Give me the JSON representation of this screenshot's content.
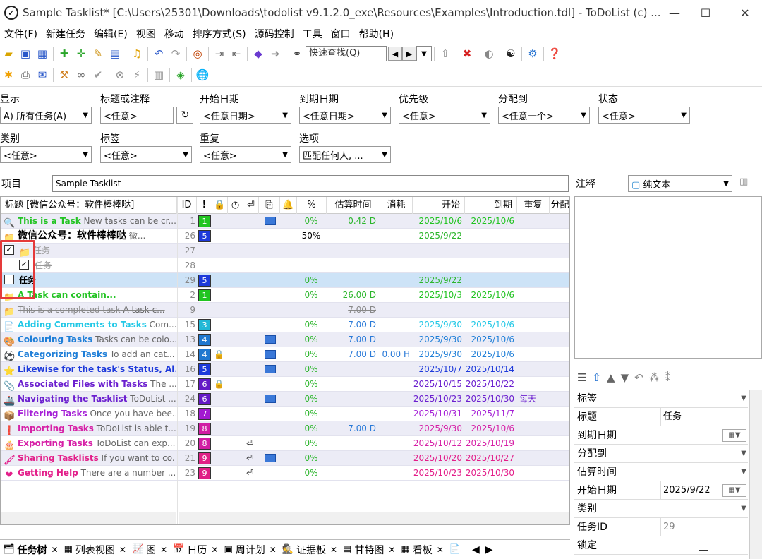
{
  "window": {
    "title": "Sample Tasklist* [C:\\Users\\25301\\Downloads\\todolist  v9.1.2.0_exe\\Resources\\Examples\\Introduction.tdl] - ToDoList (c) ...",
    "minimize": "—",
    "maximize": "☐",
    "close": "✕"
  },
  "menu": [
    "文件(F)",
    "新建任务",
    "编辑(E)",
    "视图",
    "移动",
    "排序方式(S)",
    "源码控制",
    "工具",
    "窗口",
    "帮助(H)"
  ],
  "toolbar": {
    "quick_find_placeholder": "快速查找(Q)"
  },
  "filters": {
    "show": {
      "label": "显示",
      "value": "A) 所有任务(A)"
    },
    "title_or_comment": {
      "label": "标题或注释",
      "value": "<任意>"
    },
    "start_date": {
      "label": "开始日期",
      "value": "<任意日期>"
    },
    "due_date": {
      "label": "到期日期",
      "value": "<任意日期>"
    },
    "priority": {
      "label": "优先级",
      "value": "<任意>"
    },
    "allocated_to": {
      "label": "分配到",
      "value": "<任意一个>"
    },
    "status": {
      "label": "状态",
      "value": "<任意>"
    },
    "category": {
      "label": "类别",
      "value": "<任意>"
    },
    "tags": {
      "label": "标签",
      "value": "<任意>"
    },
    "recurrence": {
      "label": "重复",
      "value": "<任意>"
    },
    "options": {
      "label": "选项",
      "value": "匹配任何人, ..."
    }
  },
  "project": {
    "label": "项目",
    "value": "Sample Tasklist"
  },
  "grid": {
    "columns": {
      "title": "标题 [微信公众号：软件棒棒哒]",
      "id": "ID",
      "priority": "!",
      "percent": "%",
      "estimate": "估算时间",
      "spent": "消耗",
      "start": "开始",
      "due": "到期",
      "recurrence": "重复",
      "alloc": "分配"
    },
    "rows": [
      {
        "title": "This is a Task",
        "comment": "New tasks can be cr...",
        "id": "1",
        "pri": "1",
        "pct": "0%",
        "est": "0.42 D",
        "spent": "",
        "start": "2025/10/6",
        "due": "2025/10/6",
        "rec": "",
        "color": "#22c322",
        "pricolor": "#21c521",
        "icon": "🔍"
      },
      {
        "title": "微信公众号：软件棒棒哒",
        "comment": "微...",
        "id": "26",
        "pri": "5",
        "pct": "50%",
        "est": "",
        "spent": "",
        "start": "2025/9/22",
        "due": "",
        "rec": "",
        "color": "#000000",
        "pricolor": "#1e3adb",
        "icon": "📁"
      },
      {
        "title": "任务",
        "comment": "",
        "id": "27",
        "pri": "",
        "pct": "",
        "est": "",
        "spent": "",
        "start": "",
        "due": "",
        "rec": "",
        "color": "#999999",
        "pricolor": "",
        "icon": "📁",
        "done": true
      },
      {
        "title": "任务",
        "comment": "",
        "id": "28",
        "pri": "",
        "pct": "",
        "est": "",
        "spent": "",
        "start": "",
        "due": "",
        "rec": "",
        "color": "#999999",
        "pricolor": "",
        "icon": "",
        "done": true
      },
      {
        "title": "任务",
        "comment": "",
        "id": "29",
        "pri": "5",
        "pct": "0%",
        "est": "",
        "spent": "",
        "start": "2025/9/22",
        "due": "",
        "rec": "",
        "color": "#000000",
        "pricolor": "#1e3adb",
        "icon": ""
      },
      {
        "title": "A Task can contain...",
        "comment": "",
        "id": "2",
        "pri": "1",
        "pct": "0%",
        "est": "26.00 D",
        "spent": "",
        "start": "2025/10/3",
        "due": "2025/10/6",
        "rec": "",
        "color": "#22c322",
        "pricolor": "#21c521",
        "icon": "📁"
      },
      {
        "title": "This is a completed task",
        "comment": "A task c...",
        "id": "9",
        "pri": "",
        "pct": "",
        "est": "7.00 D",
        "spent": "",
        "start": "",
        "due": "",
        "rec": "",
        "color": "#888888",
        "pricolor": "",
        "icon": "📁",
        "done": true
      },
      {
        "title": "Adding Comments to Tasks",
        "comment": "Com...",
        "id": "15",
        "pri": "3",
        "pct": "0%",
        "est": "7.00 D",
        "spent": "",
        "start": "2025/9/30",
        "due": "2025/10/6",
        "rec": "",
        "color": "#22c8e6",
        "pricolor": "#22b8d6",
        "icon": "📄"
      },
      {
        "title": "Colouring Tasks",
        "comment": "Tasks can be colo...",
        "id": "13",
        "pri": "4",
        "pct": "0%",
        "est": "7.00 D",
        "spent": "",
        "start": "2025/9/30",
        "due": "2025/10/6",
        "rec": "",
        "color": "#1f7fd8",
        "pricolor": "#1f77cf",
        "icon": "🎨"
      },
      {
        "title": "Categorizing Tasks",
        "comment": "To add an cat...",
        "id": "14",
        "pri": "4",
        "pct": "0%",
        "est": "7.00 D",
        "spent": "0.00 H",
        "start": "2025/9/30",
        "due": "2025/10/6",
        "rec": "",
        "color": "#1f7fd8",
        "pricolor": "#1f77cf",
        "icon": "⚽"
      },
      {
        "title": "Likewise for the task's Status, Al...",
        "comment": "",
        "id": "16",
        "pri": "5",
        "pct": "0%",
        "est": "",
        "spent": "",
        "start": "2025/10/7",
        "due": "2025/10/14",
        "rec": "",
        "color": "#1e3adb",
        "pricolor": "#1e3adb",
        "icon": "⭐"
      },
      {
        "title": "Associated Files with Tasks",
        "comment": "The ...",
        "id": "17",
        "pri": "6",
        "pct": "0%",
        "est": "",
        "spent": "",
        "start": "2025/10/15",
        "due": "2025/10/22",
        "rec": "",
        "color": "#6b1fcf",
        "pricolor": "#6519c6",
        "icon": "📎"
      },
      {
        "title": "Navigating the Tasklist",
        "comment": "ToDoList ...",
        "id": "24",
        "pri": "6",
        "pct": "0%",
        "est": "",
        "spent": "",
        "start": "2025/10/23",
        "due": "2025/10/30",
        "rec": "每天",
        "color": "#6b1fcf",
        "pricolor": "#6519c6",
        "icon": "🚢"
      },
      {
        "title": "Filtering Tasks",
        "comment": "Once you have bee...",
        "id": "18",
        "pri": "7",
        "pct": "0%",
        "est": "",
        "spent": "",
        "start": "2025/10/31",
        "due": "2025/11/7",
        "rec": "",
        "color": "#a51fd6",
        "pricolor": "#a21ad0",
        "icon": "📦"
      },
      {
        "title": "Importing Tasks",
        "comment": "ToDoList is able t...",
        "id": "19",
        "pri": "8",
        "pct": "0%",
        "est": "7.00 D",
        "spent": "",
        "start": "2025/9/30",
        "due": "2025/10/6",
        "rec": "",
        "color": "#d61fa6",
        "pricolor": "#d11ea4",
        "icon": "❗"
      },
      {
        "title": "Exporting Tasks",
        "comment": "ToDoList can exp...",
        "id": "20",
        "pri": "8",
        "pct": "0%",
        "est": "",
        "spent": "",
        "start": "2025/10/12",
        "due": "2025/10/19",
        "rec": "",
        "color": "#d61fa6",
        "pricolor": "#d11ea4",
        "icon": "🎂"
      },
      {
        "title": "Sharing Tasklists",
        "comment": "If you want to co...",
        "id": "21",
        "pri": "9",
        "pct": "0%",
        "est": "",
        "spent": "",
        "start": "2025/10/20",
        "due": "2025/10/27",
        "rec": "",
        "color": "#e31f8a",
        "pricolor": "#e01f86",
        "icon": "🖌"
      },
      {
        "title": "Getting Help",
        "comment": "There are a number ...",
        "id": "23",
        "pri": "9",
        "pct": "0%",
        "est": "",
        "spent": "",
        "start": "2025/10/23",
        "due": "2025/10/30",
        "rec": "",
        "color": "#e31f8a",
        "pricolor": "#e01f86",
        "icon": "❤"
      }
    ]
  },
  "bottom_tabs": [
    "任务树",
    "列表视图",
    "图",
    "日历",
    "周计划",
    "证据板",
    "甘特图",
    "看板"
  ],
  "comments": {
    "label": "注释",
    "format": "纯文本"
  },
  "properties": [
    {
      "key": "标签",
      "value": ""
    },
    {
      "key": "标题",
      "value": "任务"
    },
    {
      "key": "到期日期",
      "value": ""
    },
    {
      "key": "分配到",
      "value": ""
    },
    {
      "key": "估算时间",
      "value": ""
    },
    {
      "key": "开始日期",
      "value": "2025/9/22"
    },
    {
      "key": "类别",
      "value": ""
    },
    {
      "key": "任务ID",
      "value": "29"
    },
    {
      "key": "锁定",
      "value": ""
    }
  ],
  "colors": {
    "selected_row": "#cde3f7",
    "alt_row": "#ececf6",
    "highlight_box": "#e53a3a"
  }
}
